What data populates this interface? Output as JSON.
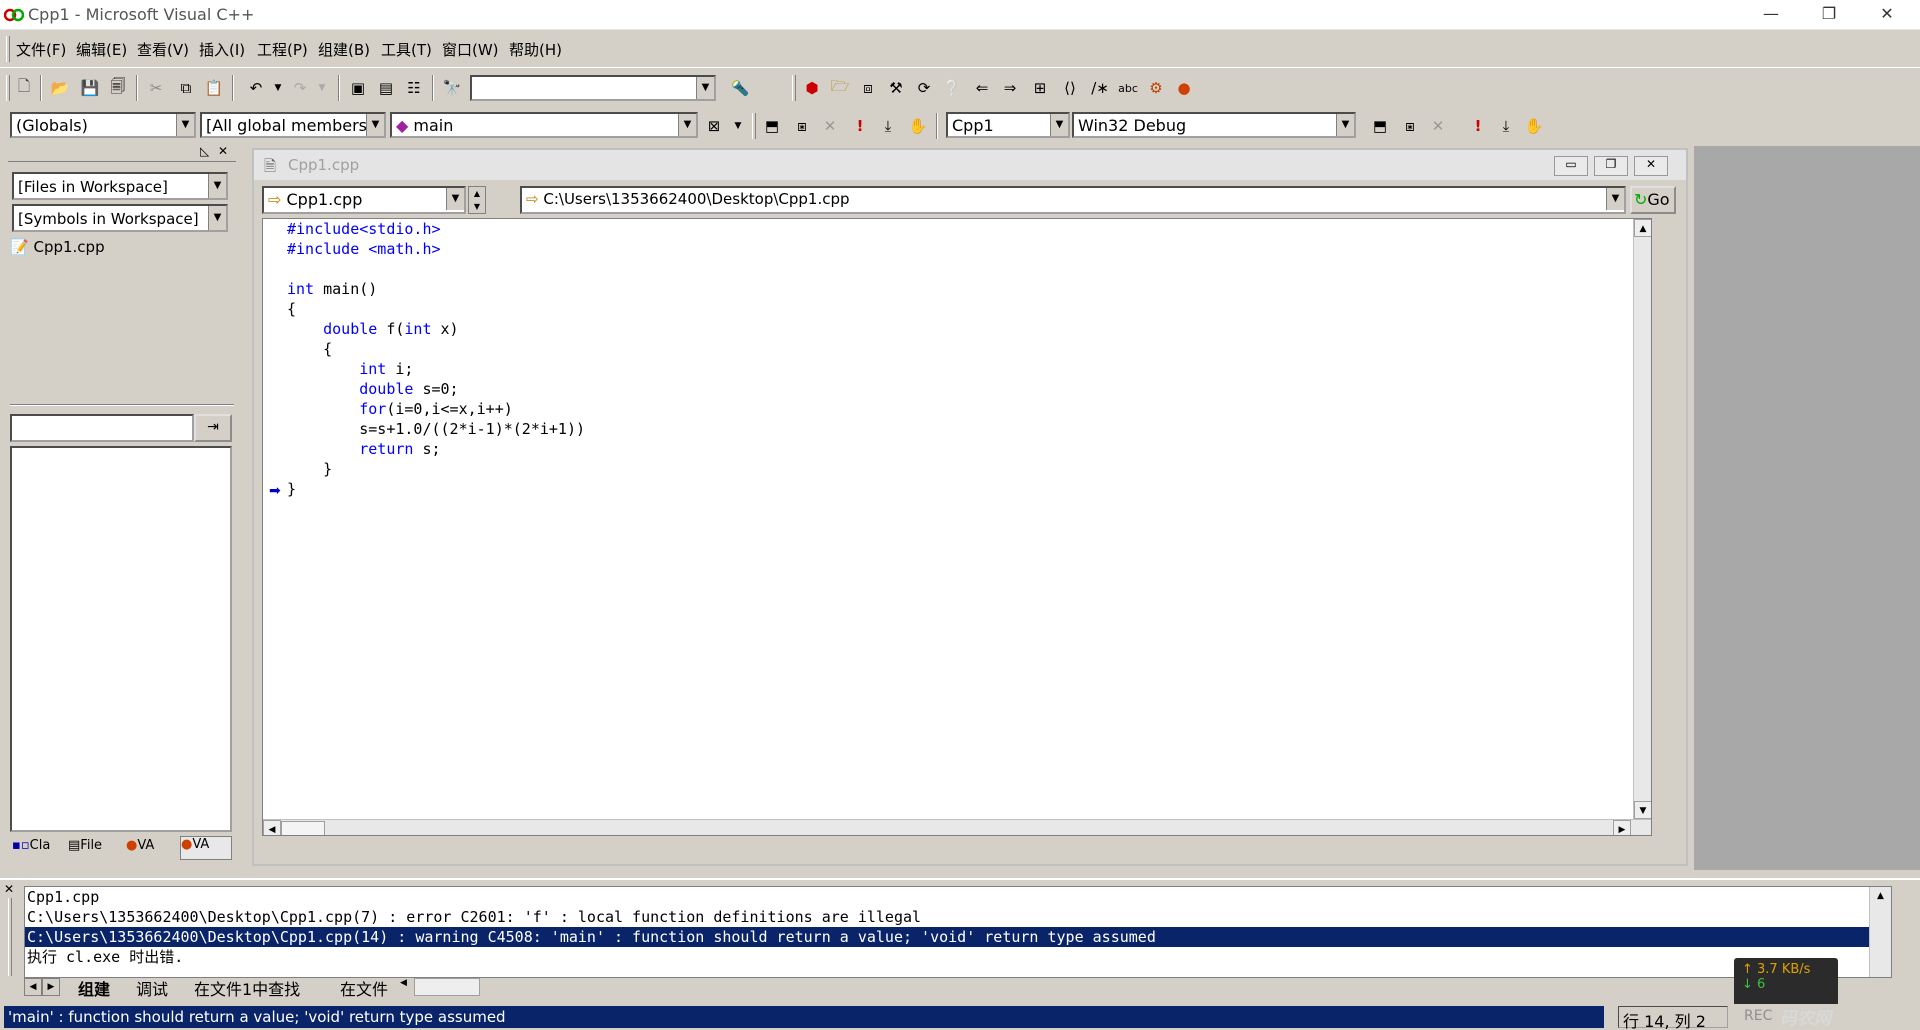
{
  "window": {
    "title": "Cpp1 - Microsoft Visual C++"
  },
  "menu": [
    "文件(F)",
    "编辑(E)",
    "查看(V)",
    "插入(I)",
    "工程(P)",
    "组建(B)",
    "工具(T)",
    "窗口(W)",
    "帮助(H)"
  ],
  "toolbar": {
    "globals_combo": "(Globals)",
    "members_combo": "[All global members",
    "function_combo": "main",
    "project_combo": "Cpp1",
    "config_combo": "Win32 Debug"
  },
  "workspace": {
    "files_combo": "[Files in Workspace]",
    "symbols_combo": "[Symbols in Workspace]",
    "file_item": "Cpp1.cpp",
    "tabs": [
      "Cla",
      "File",
      "VA",
      "VA"
    ]
  },
  "editor": {
    "caption": "Cpp1.cpp",
    "file_combo": "Cpp1.cpp",
    "path": "C:\\Users\\1353662400\\Desktop\\Cpp1.cpp",
    "go_label": "Go",
    "code_lines": [
      "#include<stdio.h>",
      "#include <math.h>",
      "",
      "int main()",
      "{",
      "    double f(int x)",
      "    {",
      "        int i;",
      "        double s=0;",
      "        for(i=0,i<=x,i++)",
      "        s=s+1.0/((2*i-1)*(2*i+1))",
      "        return s;",
      "    }",
      "}"
    ]
  },
  "output": {
    "lines": [
      "Cpp1.cpp",
      "C:\\Users\\1353662400\\Desktop\\Cpp1.cpp(7) : error C2601: 'f' : local function definitions are illegal",
      "C:\\Users\\1353662400\\Desktop\\Cpp1.cpp(14) : warning C4508: 'main' : function should return a value; 'void' return type assumed",
      "执行 cl.exe 时出错."
    ],
    "tabs": [
      "组建",
      "调试",
      "在文件1中查找",
      "在文件"
    ]
  },
  "statusbar": {
    "message": "'main' : function should return a value; 'void' return type assumed",
    "position": "行 14, 列 2",
    "rec": "REC"
  },
  "netspeed": {
    "up": "3.7 KB/s",
    "down": "6"
  },
  "watermark": "码农网 www.itcuse.com"
}
